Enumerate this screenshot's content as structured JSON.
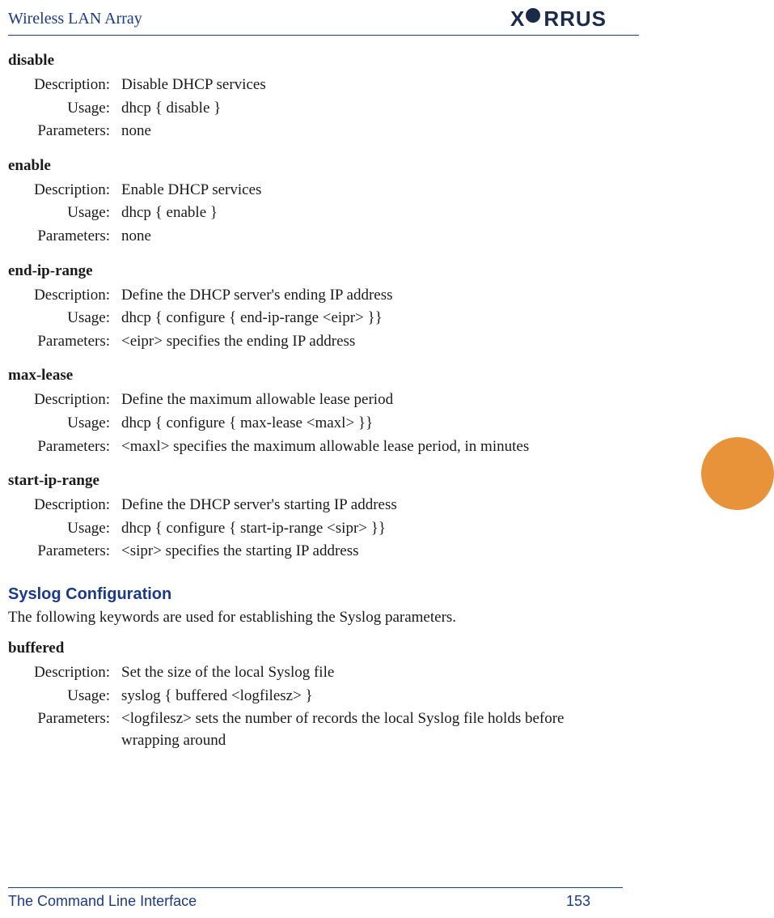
{
  "header": {
    "title": "Wireless LAN Array",
    "logo_text": "XIRRUS"
  },
  "labels": {
    "description": "Description:",
    "usage": "Usage:",
    "parameters": "Parameters:"
  },
  "commands": [
    {
      "name": "disable",
      "description": "Disable DHCP services",
      "usage": "dhcp { disable }",
      "parameters": "none"
    },
    {
      "name": "enable",
      "description": "Enable DHCP services",
      "usage": "dhcp { enable }",
      "parameters": "none"
    },
    {
      "name": "end-ip-range",
      "description": "Define the DHCP server's ending IP address",
      "usage": "dhcp { configure { end-ip-range <eipr> }}",
      "parameters": "<eipr> specifies the ending IP address"
    },
    {
      "name": "max-lease",
      "description": "Define the maximum allowable lease period",
      "usage": "dhcp { configure { max-lease <maxl> }}",
      "parameters": "<maxl> specifies the maximum allowable lease period, in minutes"
    },
    {
      "name": "start-ip-range",
      "description": "Define the DHCP server's starting IP address",
      "usage": "dhcp { configure { start-ip-range <sipr> }}",
      "parameters": "<sipr> specifies the starting IP address"
    }
  ],
  "section": {
    "heading": "Syslog Configuration",
    "intro": "The following keywords are used for establishing the Syslog parameters."
  },
  "commands2": [
    {
      "name": "buffered",
      "description": "Set the size of the local Syslog file",
      "usage": "syslog { buffered <logfilesz> }",
      "parameters": "<logfilesz> sets the number of records the local Syslog file holds before wrapping around"
    }
  ],
  "footer": {
    "chapter": "The Command Line Interface",
    "page": "153"
  }
}
